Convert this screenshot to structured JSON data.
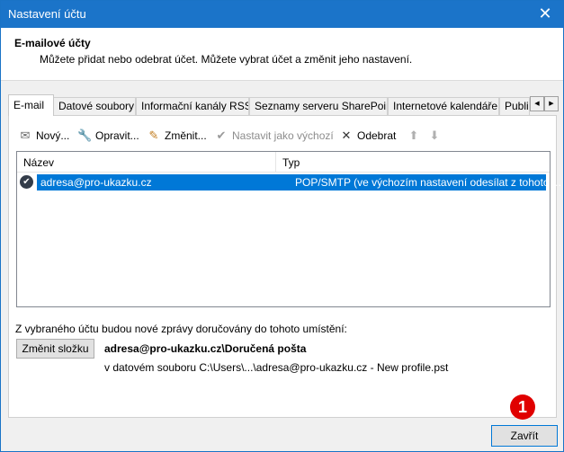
{
  "window": {
    "title": "Nastavení účtu",
    "close_glyph": "✕"
  },
  "header": {
    "title": "E-mailové účty",
    "description": "Můžete přidat nebo odebrat účet. Můžete vybrat účet a změnit jeho nastavení."
  },
  "tabs": [
    {
      "label": "E-mail"
    },
    {
      "label": "Datové soubory"
    },
    {
      "label": "Informační kanály RSS"
    },
    {
      "label": "Seznamy serveru SharePoint"
    },
    {
      "label": "Internetové kalendáře"
    },
    {
      "label": "Publi"
    }
  ],
  "tab_scroll": {
    "left": "◀",
    "right": "▶"
  },
  "toolbar": {
    "new": {
      "label": "Nový...",
      "icon": "new-account-icon",
      "glyph": "✉"
    },
    "repair": {
      "label": "Opravit...",
      "icon": "repair-icon",
      "glyph": "🔧"
    },
    "change": {
      "label": "Změnit...",
      "icon": "change-icon",
      "glyph": "✎"
    },
    "set_default": {
      "label": "Nastavit jako výchozí",
      "icon": "set-default-icon",
      "glyph": "✔"
    },
    "remove": {
      "label": "Odebrat",
      "icon": "remove-icon",
      "glyph": "✕"
    },
    "move_up": {
      "glyph": "⬆"
    },
    "move_down": {
      "glyph": "⬇"
    }
  },
  "accounts_list": {
    "columns": {
      "name": "Název",
      "type": "Typ"
    },
    "rows": [
      {
        "check": "✔",
        "name": "adresa@pro-ukazku.cz",
        "type": "POP/SMTP (ve výchozím nastavení odesílat z tohoto ..."
      }
    ]
  },
  "delivery": {
    "text": "Z vybraného účtu budou nové zprávy doručovány do tohoto umístění:",
    "change_folder_label": "Změnit složku",
    "location": "adresa@pro-ukazku.cz\\Doručená pošta",
    "data_file": "v datovém souboru C:\\Users\\...\\adresa@pro-ukazku.cz - New profile.pst"
  },
  "footer": {
    "close_label": "Zavřít",
    "step_badge": "1"
  },
  "colors": {
    "titlebar": "#1b74c9",
    "selection": "#0078d7",
    "badge": "#e00000"
  }
}
